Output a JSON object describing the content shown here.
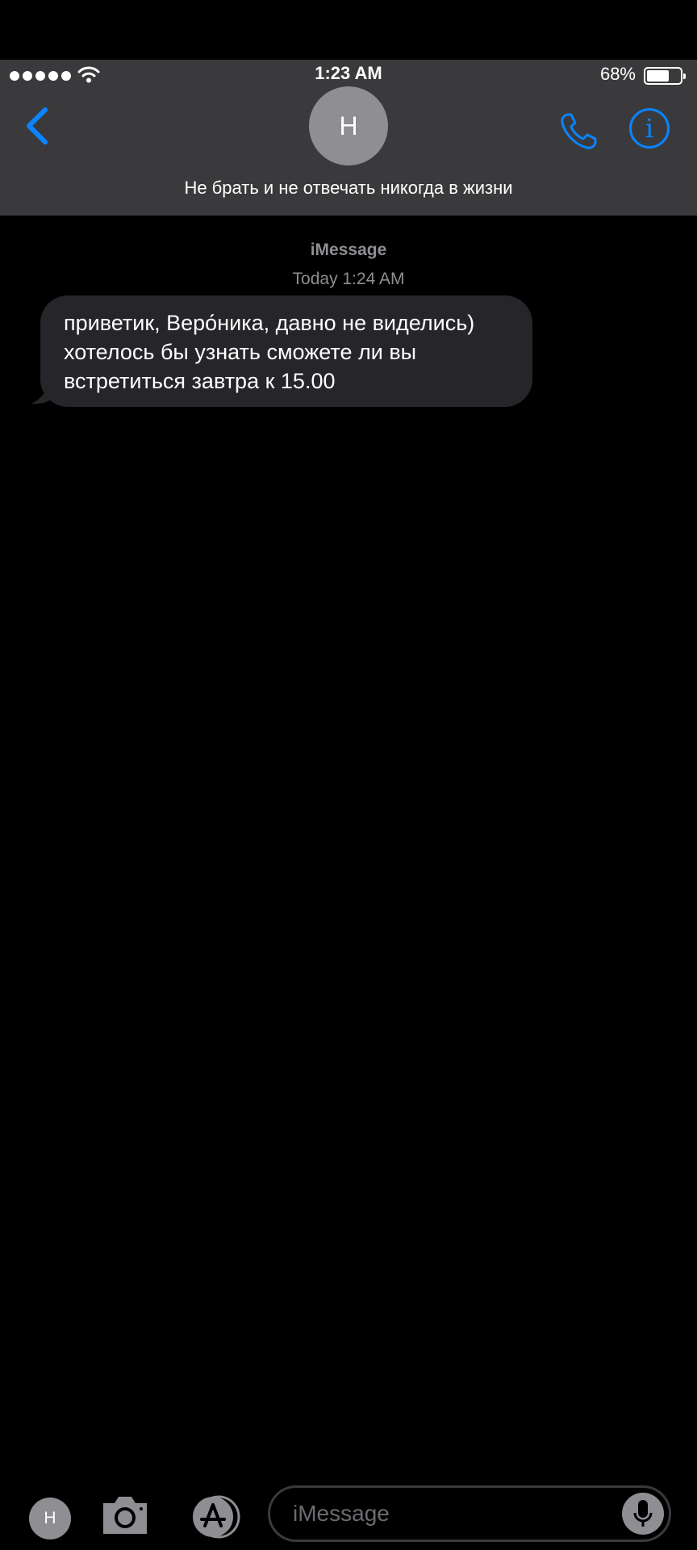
{
  "status_bar": {
    "time": "1:23 AM",
    "battery_percent": "68%",
    "battery_level": 0.68,
    "signal_bars": 5
  },
  "header": {
    "avatar_initial": "Н",
    "contact_name": "Не брать и не отвечать никогда в жизни",
    "icons": [
      "chevron-left-icon",
      "phone-icon",
      "info-icon"
    ],
    "accent_color": "#0a84ff"
  },
  "conversation": {
    "service": "iMessage",
    "timestamp": "Today 1:24 AM",
    "messages": [
      {
        "direction": "incoming",
        "text": "приветик, Веро́ника, давно не виделись) хотелось бы узнать сможете ли вы встретиться завтра к 15.00"
      }
    ]
  },
  "compose": {
    "avatar_initial": "Н",
    "placeholder": "iMessage",
    "icons": [
      "camera-icon",
      "app-store-icon",
      "microphone-icon"
    ]
  }
}
